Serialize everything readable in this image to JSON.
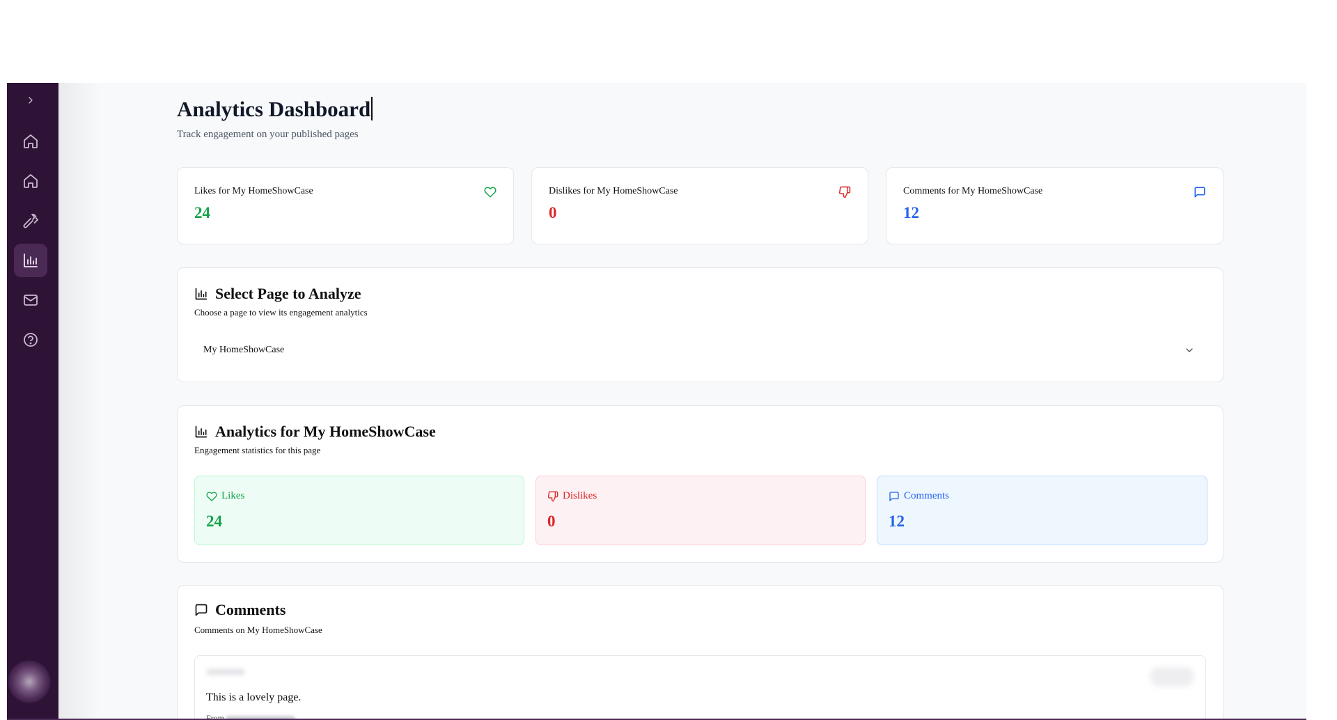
{
  "header": {
    "title": "Analytics Dashboard",
    "subtitle": "Track engagement on your published pages"
  },
  "sidebar": {
    "toggle_icon": "chevron-right-icon",
    "items": [
      {
        "icon": "home-icon",
        "active": false
      },
      {
        "icon": "home-icon",
        "active": false
      },
      {
        "icon": "hammer-icon",
        "active": false
      },
      {
        "icon": "bar-chart-icon",
        "active": true
      },
      {
        "icon": "mail-icon",
        "active": false
      },
      {
        "icon": "help-circle-icon",
        "active": false
      }
    ]
  },
  "summary": [
    {
      "label": "Likes for My HomeShowCase",
      "value": "24",
      "icon": "heart-icon",
      "color": "#16a34a"
    },
    {
      "label": "Dislikes for My HomeShowCase",
      "value": "0",
      "icon": "thumbs-down-icon",
      "color": "#dc2626"
    },
    {
      "label": "Comments for My HomeShowCase",
      "value": "12",
      "icon": "message-square-icon",
      "color": "#2563eb"
    }
  ],
  "select_page": {
    "title": "Select Page to Analyze",
    "description": "Choose a page to view its engagement analytics",
    "selected": "My HomeShowCase"
  },
  "analytics": {
    "title": "Analytics for My HomeShowCase",
    "description": "Engagement statistics for this page",
    "metrics": [
      {
        "label": "Likes",
        "value": "24"
      },
      {
        "label": "Dislikes",
        "value": "0"
      },
      {
        "label": "Comments",
        "value": "12"
      }
    ]
  },
  "comments": {
    "title": "Comments",
    "description": "Comments on My HomeShowCase",
    "items": [
      {
        "text": "This is a lovely page.",
        "from_label": "From"
      }
    ]
  },
  "colors": {
    "sidebar_bg": "#2e1336",
    "likes": "#16a34a",
    "dislikes": "#dc2626",
    "comments": "#2563eb"
  }
}
